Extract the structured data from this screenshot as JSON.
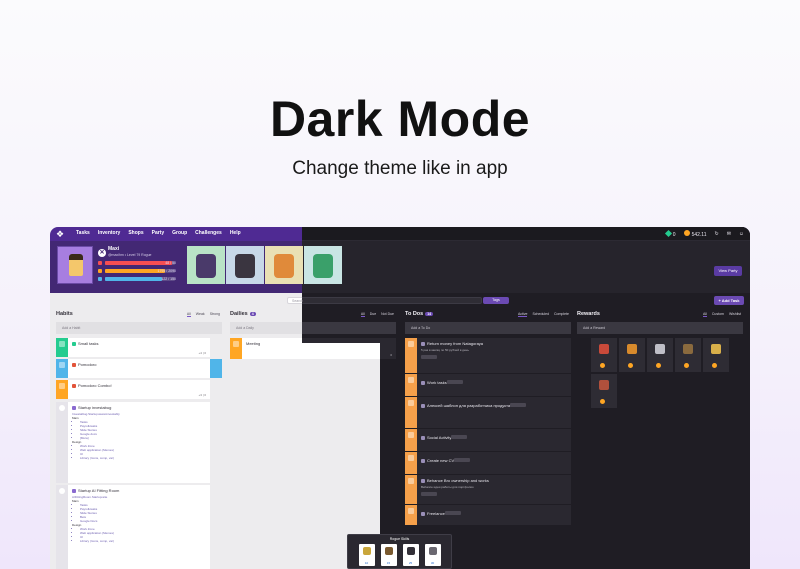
{
  "hero": {
    "title": "Dark Mode",
    "subtitle": "Change theme like in app"
  },
  "nav": {
    "links": [
      "Tasks",
      "Inventory",
      "Shops",
      "Party",
      "Group",
      "Challenges",
      "Help"
    ],
    "gems": "0",
    "gold": "542.11"
  },
  "user": {
    "name": "Maxi",
    "subtitle": "@maxihm • Level 79 Rogue",
    "bars": [
      {
        "label": "48 / 50",
        "value": 0.96,
        "color": "#f74e52"
      },
      {
        "label": "1795 / 2090",
        "value": 0.86,
        "color": "#ffa623"
      },
      {
        "label": "122 / 150",
        "value": 0.81,
        "color": "#50b5e9"
      }
    ]
  },
  "header": {
    "party_button": "View Party"
  },
  "toolbar": {
    "search_placeholder": "Search",
    "tags_label": "Tags",
    "add_task": "+ Add Task"
  },
  "habits": {
    "title": "Habits",
    "filters": [
      "All",
      "Weak",
      "Strong"
    ],
    "add_placeholder": "Add a Habit",
    "items": [
      {
        "title": "Small tasks",
        "meta": "+4 | 0",
        "color": "#24cc8f"
      },
      {
        "title": "Pomodoro",
        "meta": "",
        "color": "#50b5e9"
      },
      {
        "title": "Pomodoro Combo!",
        "meta": "+3 | 0",
        "color": "#ffa623"
      },
      {
        "title": "Startup investabug",
        "color": "#edecee"
      },
      {
        "title": "Startup AI Fitting Room",
        "color": "#edecee"
      }
    ],
    "desc1": {
      "link": "Investablug.Startup•www•investably",
      "main_label": "Main",
      "main": [
        "Tasks",
        "Payroll•tasks",
        "Slide Stories",
        "Google docs",
        "[Mura]"
      ],
      "design_label": "Design",
      "design": [
        "Work Zone",
        "Web application (Memes)",
        "UI",
        "Library (Icons, comp, var)"
      ]
    },
    "desc2": {
      "link": "AIFittingRoom.Startup•site",
      "main_label": "Main",
      "main": [
        "Tasks",
        "Payroll•tasks",
        "Slide Stories",
        "Bets",
        "Google Docs"
      ],
      "design_label": "Design",
      "design": [
        "Work Zone",
        "Web application (Memes)",
        "UI",
        "Library (Icons, comp, var)"
      ]
    }
  },
  "dailies": {
    "title": "Dailies",
    "count": "4",
    "filters": [
      "All",
      "Due",
      "Not Due"
    ],
    "add_placeholder": "Add a Daily",
    "items": [
      {
        "title": "Meeting",
        "meta": "0"
      }
    ]
  },
  "todos": {
    "title": "To Dos",
    "count": "14",
    "filters": [
      "Active",
      "Scheduled",
      "Complete"
    ],
    "add_placeholder": "Add a To Do",
    "items": [
      {
        "title": "Return money from Natagoraya",
        "sub": "5 раз в месяц по 50 рублей в день"
      },
      {
        "title": "Work tasks",
        "sub": ""
      },
      {
        "title": "Алексей шаблон для разработчика продукта",
        "sub": ""
      },
      {
        "title": "Social Activity",
        "sub": ""
      },
      {
        "title": "Create new CV",
        "sub": ""
      },
      {
        "title": "Behance Bro ownership and works",
        "sub": "Behance идеи работы для портфолио"
      },
      {
        "title": "Freelance",
        "sub": ""
      }
    ]
  },
  "rewards": {
    "title": "Rewards",
    "filters": [
      "All",
      "Custom",
      "Wishlist"
    ],
    "add_placeholder": "Add a Reward",
    "items": [
      {
        "color": "#c94a3a"
      },
      {
        "color": "#d88a2c"
      },
      {
        "color": "#bfbfc7"
      },
      {
        "color": "#8a6a3e"
      },
      {
        "color": "#d9b04a"
      },
      {
        "color": "#b0503c"
      }
    ]
  },
  "popup": {
    "title": "Rogue Skills",
    "skills": [
      {
        "cost": "10",
        "color": "#c9a63b"
      },
      {
        "cost": "15",
        "color": "#7a5a30"
      },
      {
        "cost": "25",
        "color": "#333038"
      },
      {
        "cost": "30",
        "color": "#6a6770"
      }
    ]
  }
}
